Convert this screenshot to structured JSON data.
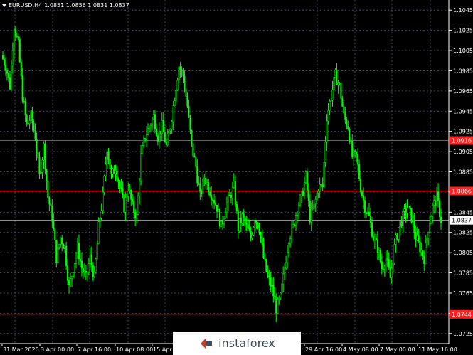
{
  "header": {
    "symbol": "EURUSD,H4",
    "ohlc": "1.0851 1.0856 1.0831 1.0837"
  },
  "price_axis": {
    "ticks": [
      "1.1045",
      "1.1025",
      "1.1005",
      "1.0985",
      "1.0965",
      "1.0945",
      "1.0925",
      "1.0905",
      "1.0885",
      "1.0865",
      "1.0845",
      "1.0825",
      "1.0805",
      "1.0785",
      "1.0765",
      "1.0745",
      "1.0725"
    ],
    "current_price": "1.0837"
  },
  "time_axis": {
    "labels": [
      "31 Mar 2020",
      "3 Apr 00:00",
      "7 Apr 16:00",
      "10 Apr 08:00",
      "15 Apr",
      "29 Apr 16:00",
      "4 May 08:00",
      "7 May 00:00",
      "11 May 16:00"
    ]
  },
  "levels": [
    {
      "price": 1.0916,
      "label": "1.0916",
      "color": "#ff2020"
    },
    {
      "price": 1.0866,
      "label": "1.0866",
      "color": "#ff2020"
    },
    {
      "price": 1.0744,
      "label": "1.0744",
      "color": "#ff2020"
    }
  ],
  "colors": {
    "candle": "#00ff00",
    "grid": "#3d4a5e",
    "level": "#ff2020",
    "current": "#c0c0c0"
  },
  "watermark": {
    "text": "instaforex",
    "icon": "instaforex-logo"
  },
  "chart_data": {
    "type": "line",
    "symbol": "EURUSD",
    "timeframe": "H4",
    "ylim": [
      1.0715,
      1.1055
    ],
    "close_path": [
      1.1,
      1.099,
      1.097,
      1.103,
      1.101,
      1.096,
      1.093,
      1.094,
      1.092,
      1.088,
      1.091,
      1.086,
      1.084,
      1.08,
      1.082,
      1.081,
      1.077,
      1.079,
      1.081,
      1.079,
      1.078,
      1.08,
      1.078,
      1.083,
      1.086,
      1.091,
      1.088,
      1.089,
      1.087,
      1.085,
      1.087,
      1.085,
      1.084,
      1.09,
      1.092,
      1.093,
      1.094,
      1.092,
      1.093,
      1.091,
      1.093,
      1.096,
      1.099,
      1.098,
      1.095,
      1.091,
      1.089,
      1.086,
      1.088,
      1.087,
      1.086,
      1.085,
      1.083,
      1.085,
      1.086,
      1.087,
      1.083,
      1.084,
      1.083,
      1.082,
      1.084,
      1.083,
      1.08,
      1.078,
      1.077,
      1.075,
      1.076,
      1.079,
      1.082,
      1.083,
      1.085,
      1.086,
      1.088,
      1.084,
      1.085,
      1.087,
      1.087,
      1.094,
      1.096,
      1.098,
      1.097,
      1.094,
      1.093,
      1.09,
      1.09,
      1.087,
      1.085,
      1.084,
      1.082,
      1.081,
      1.079,
      1.08,
      1.078,
      1.081,
      1.083,
      1.084,
      1.085,
      1.084,
      1.082,
      1.081,
      1.08,
      1.083,
      1.085,
      1.086,
      1.0837
    ]
  }
}
